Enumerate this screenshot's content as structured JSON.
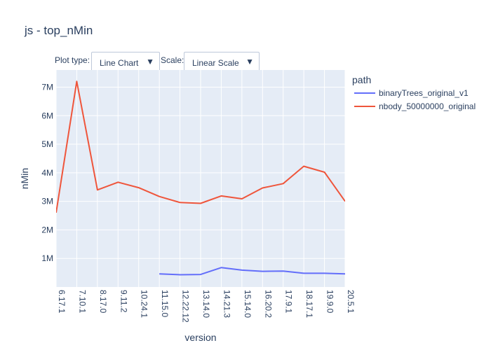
{
  "title": "js - top_nMin",
  "controls": {
    "plot_type_label": "Plot type:",
    "plot_type_value": "Line Chart",
    "scale_label": "Scale:",
    "scale_value": "Linear Scale",
    "arrow_glyph": "▼"
  },
  "chart_data": {
    "type": "line",
    "xlabel": "version",
    "ylabel": "nMin",
    "legend_title": "path",
    "legend_position": "right",
    "grid": true,
    "background": "#e5ecf6",
    "categories": [
      "6.17.1",
      "7.10.1",
      "8.17.0",
      "9.11.2",
      "10.24.1",
      "11.15.0",
      "12.22.12",
      "13.14.0",
      "14.21.3",
      "15.14.0",
      "16.20.2",
      "17.9.1",
      "18.17.1",
      "19.9.0",
      "20.5.1"
    ],
    "ylim": [
      0,
      7600000
    ],
    "yticks": [
      1000000,
      2000000,
      3000000,
      4000000,
      5000000,
      6000000,
      7000000
    ],
    "ytick_labels": [
      "1M",
      "2M",
      "3M",
      "4M",
      "5M",
      "6M",
      "7M"
    ],
    "series": [
      {
        "name": "binaryTrees_original_v1",
        "color": "#636efa",
        "values": [
          null,
          null,
          null,
          null,
          null,
          460000,
          430000,
          440000,
          680000,
          590000,
          550000,
          560000,
          480000,
          480000,
          460000
        ]
      },
      {
        "name": "nbody_50000000_original",
        "color": "#ef553b",
        "values": [
          2600000,
          7200000,
          3400000,
          3670000,
          3480000,
          3170000,
          2960000,
          2930000,
          3190000,
          3090000,
          3470000,
          3620000,
          4230000,
          4020000,
          3000000
        ]
      }
    ]
  }
}
